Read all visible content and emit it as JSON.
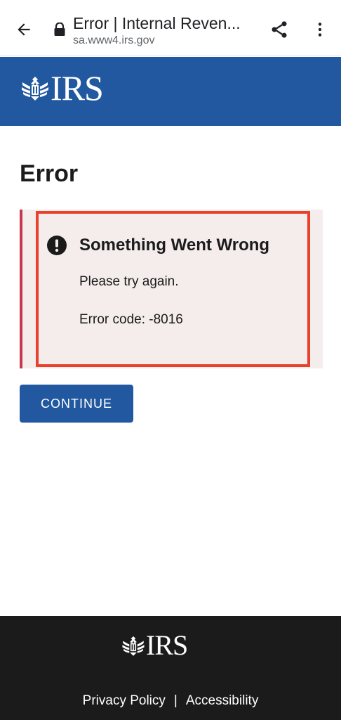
{
  "browser": {
    "tab_title": "Error | Internal Reven...",
    "url": "sa.www4.irs.gov"
  },
  "header": {
    "logo_text": "IRS"
  },
  "main": {
    "title": "Error",
    "alert": {
      "heading": "Something Went Wrong",
      "message": "Please try again.",
      "error_code": "Error code: -8016"
    },
    "continue_label": "CONTINUE"
  },
  "footer": {
    "logo_text": "IRS",
    "links": [
      "Privacy Policy",
      "Accessibility"
    ],
    "separator": "|"
  },
  "colors": {
    "brand_blue": "#22589f",
    "alert_bg": "#f4edec",
    "alert_accent": "#c9374c",
    "highlight_outline": "#e8412c",
    "footer_bg": "#1b1b1b"
  },
  "icons": [
    "back-arrow-icon",
    "lock-icon",
    "share-icon",
    "more-vert-icon",
    "eagle-icon",
    "exclamation-icon"
  ]
}
